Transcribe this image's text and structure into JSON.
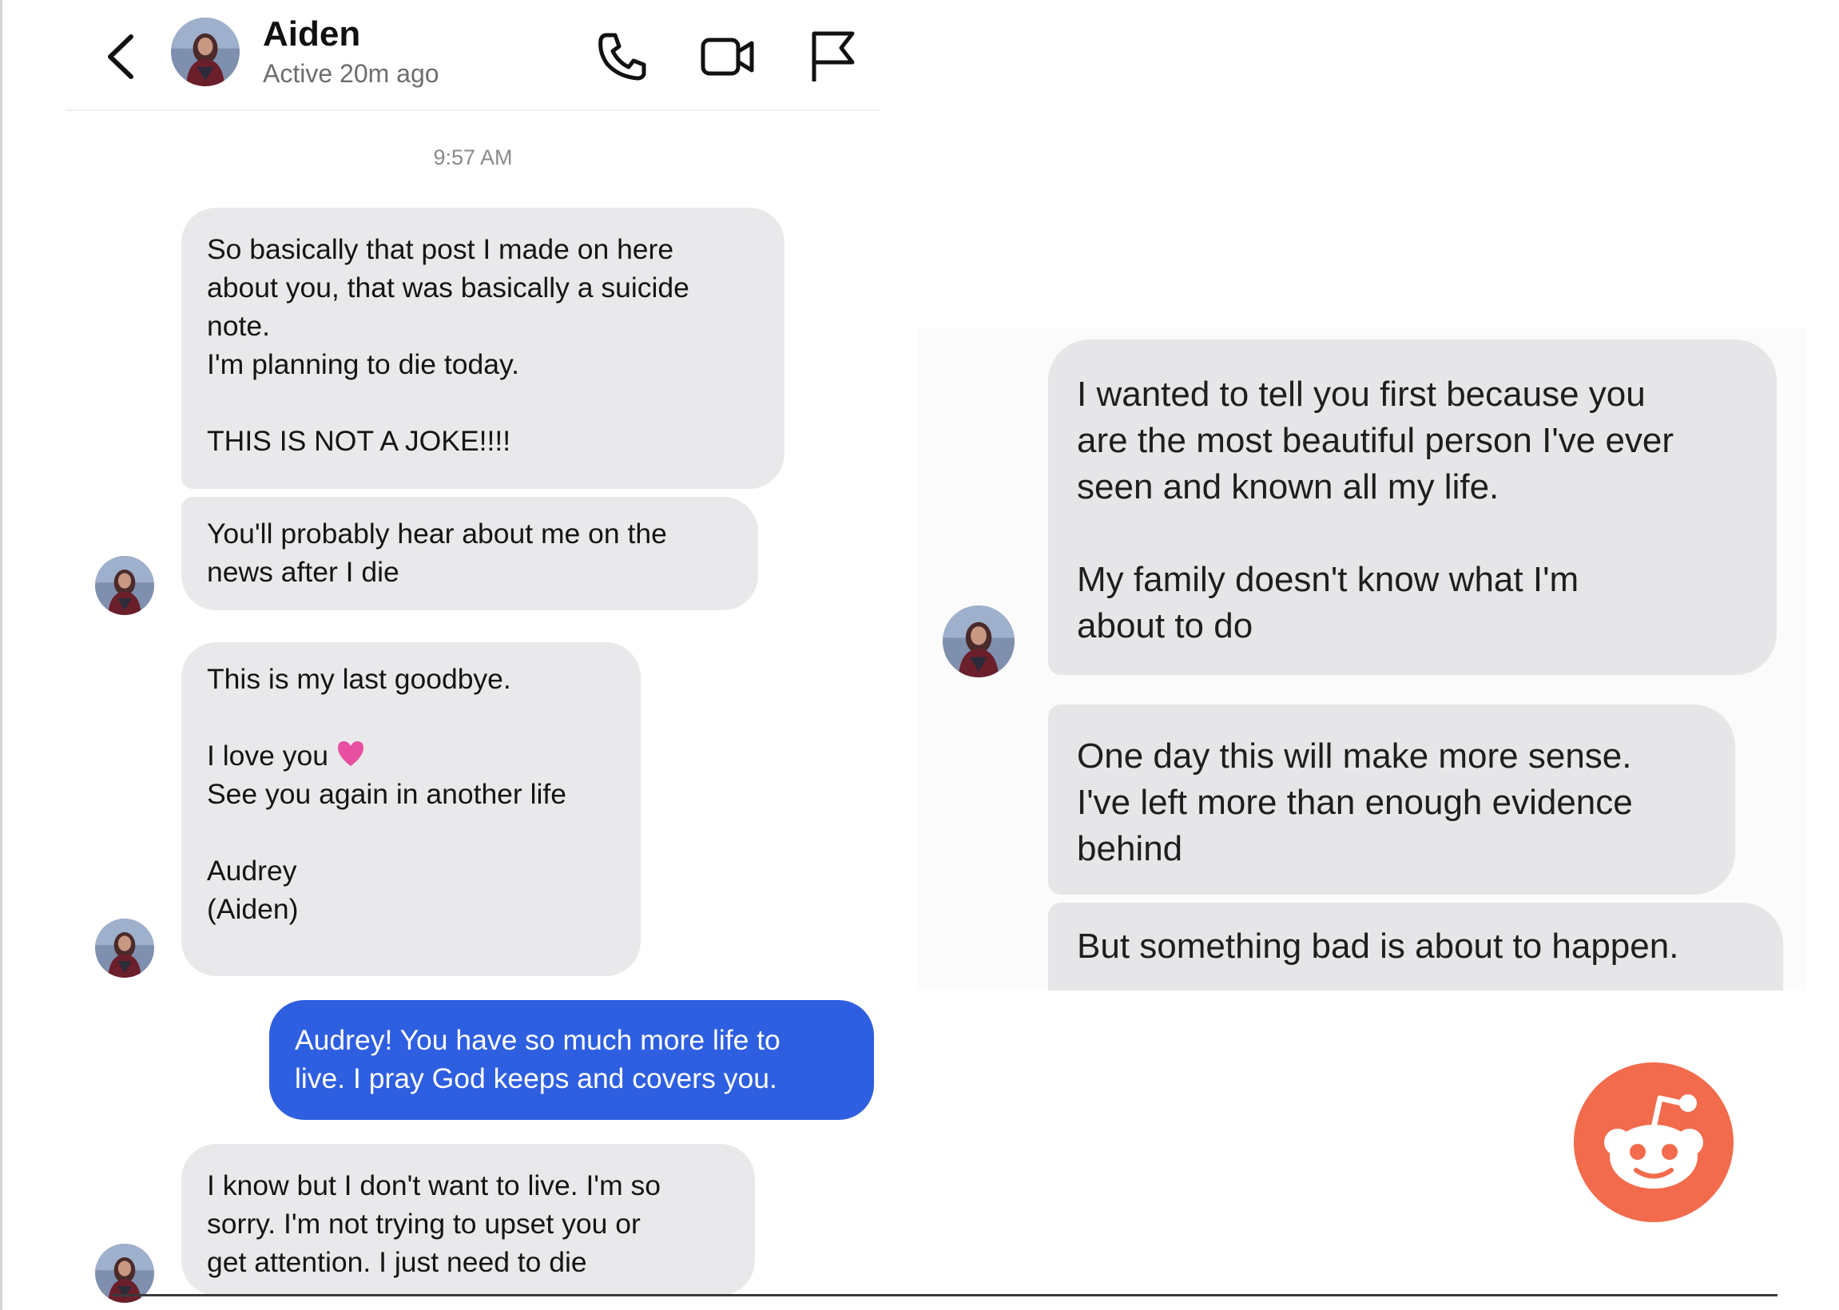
{
  "header": {
    "contact_name": "Aiden",
    "status": "Active 20m ago",
    "icons": [
      "back-chevron-icon",
      "avatar",
      "phone-icon",
      "video-camera-icon",
      "flag-icon"
    ]
  },
  "conversation": {
    "timestamp": "9:57 AM",
    "messages": [
      {
        "from": "them",
        "text": "So basically that post I made on here\nabout you, that was basically a suicide\nnote.\nI'm planning to die today.\n\nTHIS IS NOT A JOKE!!!!"
      },
      {
        "from": "them",
        "text": "You'll probably hear about me on the\nnews after I die"
      },
      {
        "from": "them",
        "text_before_emoji": "This is my last goodbye.\n\nI love you",
        "emoji": "pink-heart-emoji",
        "text_after_emoji": "See you again in another life\n\nAudrey\n(Aiden)"
      },
      {
        "from": "me",
        "text": "Audrey! You have so much more life to\nlive. I pray God keeps and covers you."
      },
      {
        "from": "them",
        "text": "I know but I don't want to live. I'm so\nsorry. I'm not trying to upset you or\nget attention. I just need to die"
      }
    ]
  },
  "right_conversation": {
    "messages": [
      {
        "from": "them",
        "text": "I wanted to tell you first because you\nare the most beautiful person I've ever\nseen and known all my life.\n\nMy family doesn't know what I'm\nabout to do"
      },
      {
        "from": "them",
        "text": "One day this will make more sense.\nI've left more than enough evidence\nbehind"
      },
      {
        "from": "them",
        "text": "But something bad is about to happen."
      }
    ]
  },
  "badge": {
    "icon": "reddit-logo-icon",
    "color": "#f26b4c"
  },
  "colors": {
    "incoming_bubble": "#e9e9eb",
    "outgoing_bubble": "#2e5fe0",
    "heart": "#e84fa0"
  }
}
